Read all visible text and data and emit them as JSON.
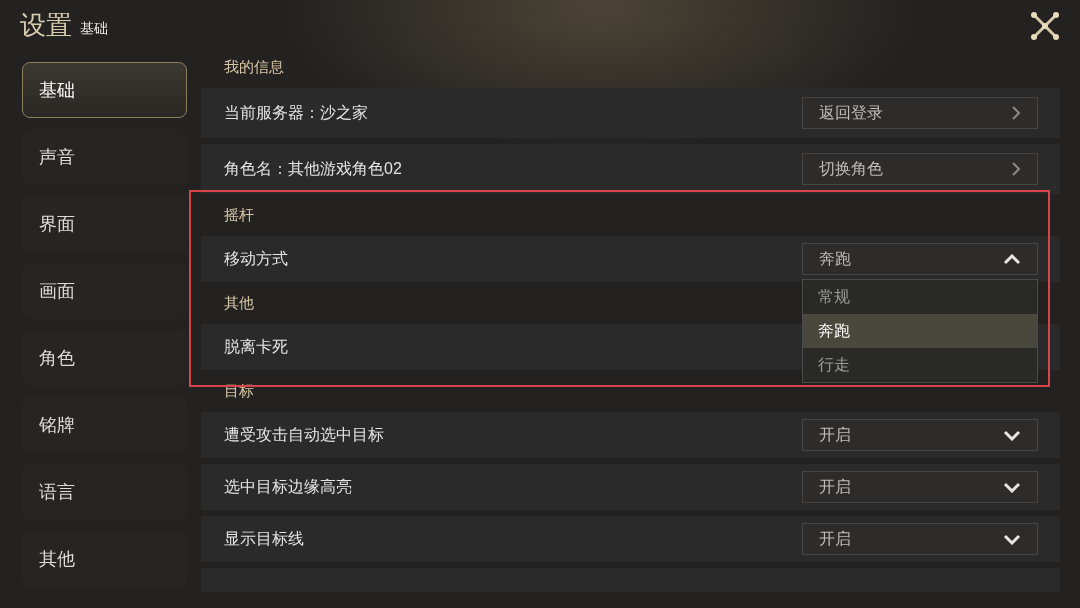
{
  "window": {
    "title": "设置",
    "subtitle": "基础"
  },
  "sidebar": {
    "items": [
      {
        "label": "基础",
        "selected": true
      },
      {
        "label": "声音",
        "selected": false
      },
      {
        "label": "界面",
        "selected": false
      },
      {
        "label": "画面",
        "selected": false
      },
      {
        "label": "角色",
        "selected": false
      },
      {
        "label": "铭牌",
        "selected": false
      },
      {
        "label": "语言",
        "selected": false
      },
      {
        "label": "其他",
        "selected": false
      }
    ]
  },
  "sections": [
    {
      "heading": "我的信息",
      "rows": [
        {
          "kind": "link",
          "label": "当前服务器：沙之家",
          "button": "返回登录"
        },
        {
          "kind": "link",
          "label": "角色名：其他游戏角色02",
          "button": "切换角色"
        }
      ]
    },
    {
      "heading": "摇杆",
      "rows": [
        {
          "kind": "dropdown",
          "label": "移动方式",
          "value": "奔跑",
          "expanded": true,
          "options": [
            {
              "label": "常规",
              "selected": false
            },
            {
              "label": "奔跑",
              "selected": true
            },
            {
              "label": "行走",
              "selected": false
            }
          ]
        }
      ]
    },
    {
      "heading": "其他",
      "rows": [
        {
          "kind": "plain",
          "label": "脱离卡死"
        }
      ]
    },
    {
      "heading": "目标",
      "rows": [
        {
          "kind": "dropdown",
          "label": "遭受攻击自动选中目标",
          "value": "开启",
          "expanded": false
        },
        {
          "kind": "dropdown",
          "label": "选中目标边缘高亮",
          "value": "开启",
          "expanded": false
        },
        {
          "kind": "dropdown",
          "label": "显示目标线",
          "value": "开启",
          "expanded": false
        }
      ]
    }
  ],
  "highlight_frame": true
}
